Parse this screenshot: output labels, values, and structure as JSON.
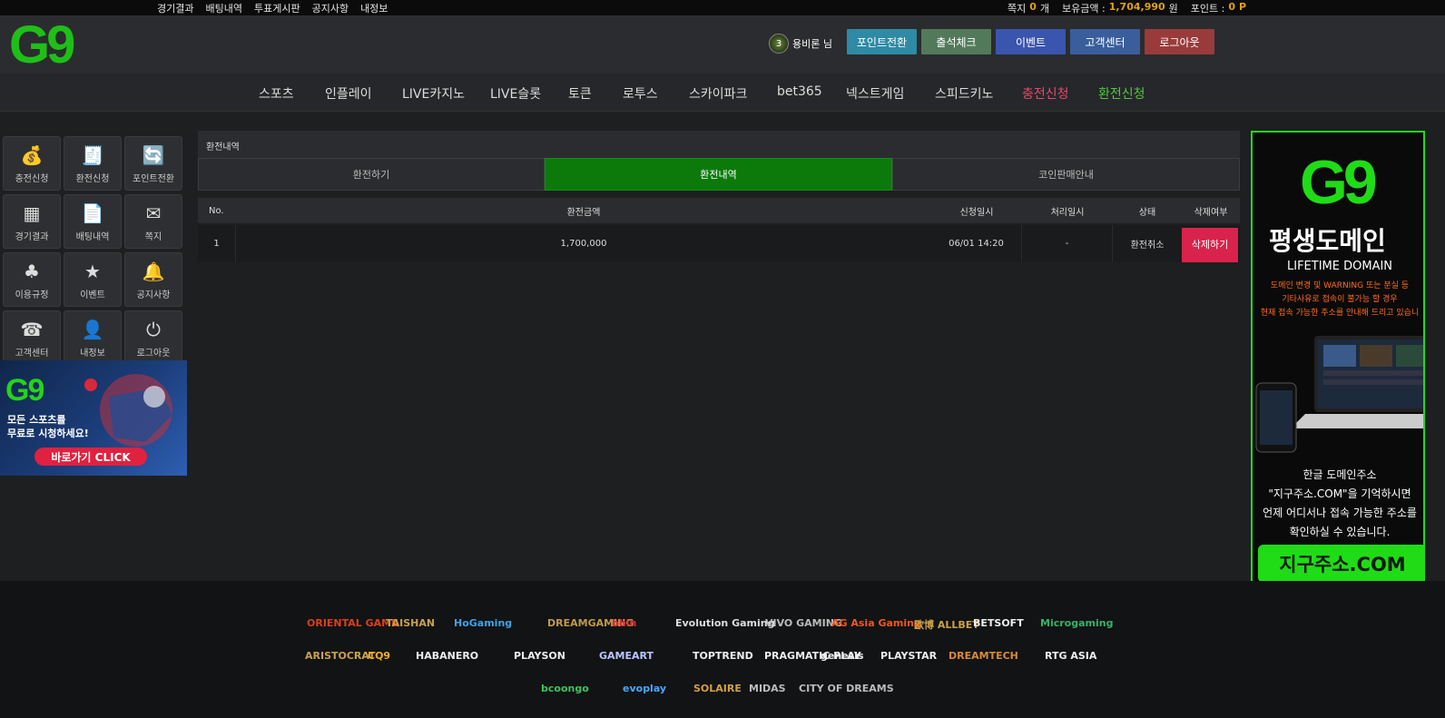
{
  "topbar": {
    "links": [
      "경기결과",
      "배팅내역",
      "투표게시판",
      "공지사항",
      "내정보"
    ],
    "memo_label": "쪽지",
    "memo_count": "0",
    "memo_unit": "개",
    "balance_label": "보유금액 :",
    "balance_value": "1,704,990",
    "balance_unit": "원",
    "point_label": "포인트 :",
    "point_value": "0",
    "point_unit": "P"
  },
  "header": {
    "logo": "G9",
    "user_level": "3",
    "user_name": "용비론 님",
    "buttons": [
      {
        "label": "포인트전환",
        "color": "#2e8aa5"
      },
      {
        "label": "출석체크",
        "color": "#527a5a"
      },
      {
        "label": "이벤트",
        "color": "#3a55ad"
      },
      {
        "label": "고객센터",
        "color": "#3a5e9c"
      },
      {
        "label": "로그아웃",
        "color": "#9a3b3b"
      }
    ]
  },
  "nav": {
    "items": [
      {
        "label": "스포츠",
        "color": "#dddddd"
      },
      {
        "label": "인플레이",
        "color": "#dddddd"
      },
      {
        "label": "LIVE카지노",
        "color": "#dddddd"
      },
      {
        "label": "LIVE슬롯",
        "color": "#dddddd"
      },
      {
        "label": "토큰",
        "color": "#dddddd"
      },
      {
        "label": "로투스",
        "color": "#dddddd"
      },
      {
        "label": "스카이파크",
        "color": "#dddddd"
      },
      {
        "label": "bet365",
        "color": "#dddddd"
      },
      {
        "label": "넥스트게임",
        "color": "#dddddd"
      },
      {
        "label": "스피드키노",
        "color": "#dddddd"
      },
      {
        "label": "충전신청",
        "color": "#e84a6a"
      },
      {
        "label": "환전신청",
        "color": "#4ec83c"
      }
    ]
  },
  "sidebar": {
    "items": [
      {
        "label": "충전신청",
        "icon": "money-bag-icon",
        "glyph": "💰"
      },
      {
        "label": "환전신청",
        "icon": "receipt-icon",
        "glyph": "🧾"
      },
      {
        "label": "포인트전환",
        "icon": "exchange-icon",
        "glyph": "🔄"
      },
      {
        "label": "경기결과",
        "icon": "scoreboard-icon",
        "glyph": "▦"
      },
      {
        "label": "배팅내역",
        "icon": "document-icon",
        "glyph": "📄"
      },
      {
        "label": "쪽지",
        "icon": "envelope-icon",
        "glyph": "✉"
      },
      {
        "label": "이용규정",
        "icon": "clover-icon",
        "glyph": "♣"
      },
      {
        "label": "이벤트",
        "icon": "star-icon",
        "glyph": "★"
      },
      {
        "label": "공지사항",
        "icon": "bell-icon",
        "glyph": "🔔"
      },
      {
        "label": "고객센터",
        "icon": "support-247-icon",
        "glyph": "☎"
      },
      {
        "label": "내정보",
        "icon": "user-icon",
        "glyph": "👤"
      },
      {
        "label": "로그아웃",
        "icon": "power-icon",
        "glyph": "⏻"
      }
    ],
    "banner": {
      "logo": "G9",
      "line1": "모든 스포츠를",
      "line2": "무료로 시청하세요!",
      "cta": "바로가기 CLICK"
    }
  },
  "main": {
    "title": "환전내역",
    "tabs": [
      {
        "label": "환전하기",
        "active": false
      },
      {
        "label": "환전내역",
        "active": true
      },
      {
        "label": "코인판매안내",
        "active": false
      }
    ],
    "columns": [
      "No.",
      "환전금액",
      "신청일시",
      "처리일시",
      "상태",
      "삭제여부"
    ],
    "rows": [
      {
        "no": "1",
        "amount": "1,700,000",
        "requested": "06/01 14:20",
        "processed": "-",
        "status": "환전취소",
        "action": "삭제하기"
      }
    ]
  },
  "right_ad": {
    "logo": "G9",
    "title": "평생도메인",
    "subtitle": "LIFETIME DOMAIN",
    "notice1": "도메인 변경 및 WARNING 또는 분실 등",
    "notice2": "기타사유로 접속이 불가능 할 경우",
    "notice3": "현재 접속 가능한 주소를 안내해 드리고 있습니",
    "desc1": "한글 도메인주소",
    "desc2": "\"지구주소.COM\"을 기억하시면",
    "desc3": "언제 어디서나 접속 가능한 주소를",
    "desc4": "확인하실 수 있습니다.",
    "domain": "지구주소.COM"
  },
  "footer": {
    "providers": [
      {
        "name": "ORIENTAL GAME",
        "color": "#d8401c"
      },
      {
        "name": "TAISHAN",
        "color": "#c9a24a"
      },
      {
        "name": "HoGaming",
        "color": "#3aa3e8"
      },
      {
        "name": "DREAMGAMING",
        "color": "#c29a4a"
      },
      {
        "name": "bbin",
        "color": "#e0283a"
      },
      {
        "name": "Evolution Gaming",
        "color": "#dddddd"
      },
      {
        "name": "VIVO GAMING",
        "color": "#bbbbbb"
      },
      {
        "name": "AG Asia Gaming",
        "color": "#f1571f"
      },
      {
        "name": "欧博 ALLBET",
        "color": "#c9a24a"
      },
      {
        "name": "BETSOFT",
        "color": "#eeeeee"
      },
      {
        "name": "Microgaming",
        "color": "#35b26a"
      },
      {
        "name": "ARISTOCRAT",
        "color": "#c9a24a"
      },
      {
        "name": "CQ9",
        "color": "#f2b01e"
      },
      {
        "name": "HABANERO",
        "color": "#eeeeee"
      },
      {
        "name": "PLAYSON",
        "color": "#eeeeee"
      },
      {
        "name": "GAMEART",
        "color": "#b9c6ff"
      },
      {
        "name": "TOPTREND",
        "color": "#eeeeee"
      },
      {
        "name": "PRAGMATIC PLAY",
        "color": "#eeeeee"
      },
      {
        "name": "genesis",
        "color": "#eeeeee"
      },
      {
        "name": "PLAYSTAR",
        "color": "#eeeeee"
      },
      {
        "name": "DREAMTECH",
        "color": "#d88a33"
      },
      {
        "name": "RTG ASIA",
        "color": "#eeeeee"
      },
      {
        "name": "bcoongo",
        "color": "#3ac35a"
      },
      {
        "name": "evoplay",
        "color": "#48a8ff"
      },
      {
        "name": "SOLAIRE",
        "color": "#d0a04a"
      },
      {
        "name": "MIDAS",
        "color": "#bbbbbb"
      },
      {
        "name": "CITY OF DREAMS",
        "color": "#bbbbbb"
      }
    ]
  },
  "colors": {
    "accent_green": "#0b7a0b",
    "delete_red": "#d9234c",
    "brand_green": "#1fdc17"
  }
}
